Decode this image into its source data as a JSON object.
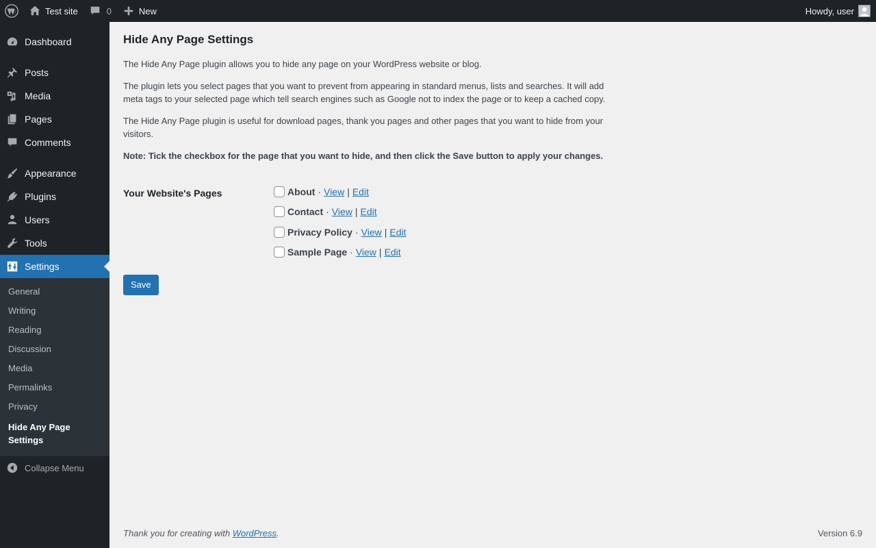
{
  "adminbar": {
    "site_name": "Test site",
    "comments_count": "0",
    "new_label": "New",
    "howdy": "Howdy, user"
  },
  "sidebar": {
    "dashboard": "Dashboard",
    "posts": "Posts",
    "media": "Media",
    "pages": "Pages",
    "comments": "Comments",
    "appearance": "Appearance",
    "plugins": "Plugins",
    "users": "Users",
    "tools": "Tools",
    "settings": "Settings",
    "submenu": [
      "General",
      "Writing",
      "Reading",
      "Discussion",
      "Media",
      "Permalinks",
      "Privacy",
      "Hide Any Page Settings"
    ],
    "collapse": "Collapse Menu"
  },
  "main": {
    "title": "Hide Any Page Settings",
    "desc1": "The Hide Any Page plugin allows you to hide any page on your WordPress website or blog.",
    "desc2": "The plugin lets you select pages that you want to prevent from appearing in standard menus, lists and searches. It will add meta tags to your selected page which tell search engines such as Google not to index the page or to keep a cached copy.",
    "desc3": "The Hide Any Page plugin is useful for download pages, thank you pages and other pages that you want to hide from your visitors.",
    "note": "Note: Tick the checkbox for the page that you want to hide, and then click the Save button to apply your changes.",
    "pages_label": "Your Website's Pages",
    "pages": [
      {
        "title": "About",
        "view": "View",
        "edit": "Edit",
        "checked": false
      },
      {
        "title": "Contact",
        "view": "View",
        "edit": "Edit",
        "checked": false
      },
      {
        "title": "Privacy Policy",
        "view": "View",
        "edit": "Edit",
        "checked": false
      },
      {
        "title": "Sample Page",
        "view": "View",
        "edit": "Edit",
        "checked": false
      }
    ],
    "dot": "·",
    "bar": "|",
    "save": "Save"
  },
  "footer": {
    "thanks_prefix": "Thank you for creating with ",
    "wp_link": "WordPress",
    "thanks_suffix": ".",
    "version": "Version 6.9"
  }
}
